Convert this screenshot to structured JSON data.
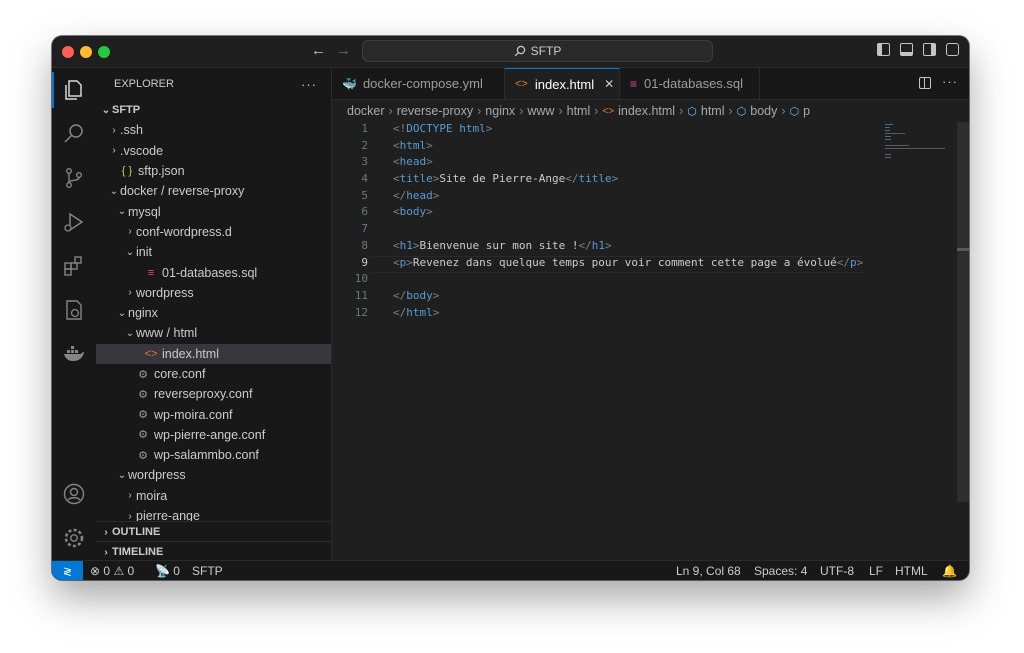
{
  "titlebar": {
    "command_center": "SFTP",
    "back_icon": "arrow-left-icon",
    "forward_icon": "arrow-right-icon"
  },
  "sidebar": {
    "title": "EXPLORER",
    "more": "···",
    "root": "SFTP",
    "items": [
      {
        "label": ".ssh",
        "depth": 1,
        "chevron": "›",
        "icon": ""
      },
      {
        "label": ".vscode",
        "depth": 1,
        "chevron": "›",
        "icon": ""
      },
      {
        "label": "sftp.json",
        "depth": 1,
        "chevron": "",
        "icon": "{ }"
      },
      {
        "label": "docker / reverse-proxy",
        "depth": 1,
        "chevron": "⌄",
        "icon": ""
      },
      {
        "label": "mysql",
        "depth": 2,
        "chevron": "⌄",
        "icon": ""
      },
      {
        "label": "conf-wordpress.d",
        "depth": 3,
        "chevron": "›",
        "icon": ""
      },
      {
        "label": "init",
        "depth": 3,
        "chevron": "⌄",
        "icon": ""
      },
      {
        "label": "01-databases.sql",
        "depth": 4,
        "chevron": "",
        "icon": "≡"
      },
      {
        "label": "wordpress",
        "depth": 3,
        "chevron": "›",
        "icon": ""
      },
      {
        "label": "nginx",
        "depth": 2,
        "chevron": "⌄",
        "icon": ""
      },
      {
        "label": "www / html",
        "depth": 3,
        "chevron": "⌄",
        "icon": ""
      },
      {
        "label": "index.html",
        "depth": 4,
        "chevron": "",
        "icon": "<>"
      },
      {
        "label": "core.conf",
        "depth": 3,
        "chevron": "",
        "icon": "⚙"
      },
      {
        "label": "reverseproxy.conf",
        "depth": 3,
        "chevron": "",
        "icon": "⚙"
      },
      {
        "label": "wp-moira.conf",
        "depth": 3,
        "chevron": "",
        "icon": "⚙"
      },
      {
        "label": "wp-pierre-ange.conf",
        "depth": 3,
        "chevron": "",
        "icon": "⚙"
      },
      {
        "label": "wp-salammbo.conf",
        "depth": 3,
        "chevron": "",
        "icon": "⚙"
      },
      {
        "label": "wordpress",
        "depth": 2,
        "chevron": "⌄",
        "icon": ""
      },
      {
        "label": "moira",
        "depth": 3,
        "chevron": "›",
        "icon": ""
      },
      {
        "label": "pierre-ange",
        "depth": 3,
        "chevron": "›",
        "icon": ""
      }
    ],
    "outline": "OUTLINE",
    "timeline": "TIMELINE"
  },
  "tabs": [
    {
      "label": "docker-compose.yml",
      "icon": "docker-icon",
      "active": false
    },
    {
      "label": "index.html",
      "icon": "html-icon",
      "active": true,
      "close": "✕"
    },
    {
      "label": "01-databases.sql",
      "icon": "database-icon",
      "active": false
    }
  ],
  "breadcrumbs": [
    "docker",
    "reverse-proxy",
    "nginx",
    "www",
    "html",
    "index.html",
    "html",
    "body",
    "p"
  ],
  "code": {
    "lines": [
      {
        "n": "1",
        "parts": [
          [
            "pun",
            "<!"
          ],
          [
            "doc",
            "DOCTYPE"
          ],
          [
            "txt",
            " "
          ],
          [
            "tag",
            "html"
          ],
          [
            "pun",
            ">"
          ]
        ]
      },
      {
        "n": "2",
        "parts": [
          [
            "pun",
            "<"
          ],
          [
            "tag",
            "html"
          ],
          [
            "pun",
            ">"
          ]
        ]
      },
      {
        "n": "3",
        "parts": [
          [
            "pun",
            "<"
          ],
          [
            "tag",
            "head"
          ],
          [
            "pun",
            ">"
          ]
        ]
      },
      {
        "n": "4",
        "parts": [
          [
            "pun",
            "<"
          ],
          [
            "tag",
            "title"
          ],
          [
            "pun",
            ">"
          ],
          [
            "txt",
            "Site de Pierre-Ange"
          ],
          [
            "pun",
            "</"
          ],
          [
            "tag",
            "title"
          ],
          [
            "pun",
            ">"
          ]
        ]
      },
      {
        "n": "5",
        "parts": [
          [
            "pun",
            "</"
          ],
          [
            "tag",
            "head"
          ],
          [
            "pun",
            ">"
          ]
        ]
      },
      {
        "n": "6",
        "parts": [
          [
            "pun",
            "<"
          ],
          [
            "tag",
            "body"
          ],
          [
            "pun",
            ">"
          ]
        ]
      },
      {
        "n": "7",
        "parts": []
      },
      {
        "n": "8",
        "parts": [
          [
            "pun",
            "<"
          ],
          [
            "tag",
            "h1"
          ],
          [
            "pun",
            ">"
          ],
          [
            "txt",
            "Bienvenue sur mon site !"
          ],
          [
            "pun",
            "</"
          ],
          [
            "tag",
            "h1"
          ],
          [
            "pun",
            ">"
          ]
        ]
      },
      {
        "n": "9",
        "parts": [
          [
            "pun",
            "<"
          ],
          [
            "tag",
            "p"
          ],
          [
            "pun",
            ">"
          ],
          [
            "txt",
            "Revenez dans quelque temps pour voir comment cette page a évolué"
          ],
          [
            "pun",
            "</"
          ],
          [
            "tag",
            "p"
          ],
          [
            "pun",
            ">"
          ]
        ]
      },
      {
        "n": "10",
        "parts": []
      },
      {
        "n": "11",
        "parts": [
          [
            "pun",
            "</"
          ],
          [
            "tag",
            "body"
          ],
          [
            "pun",
            ">"
          ]
        ]
      },
      {
        "n": "12",
        "parts": [
          [
            "pun",
            "</"
          ],
          [
            "tag",
            "html"
          ],
          [
            "pun",
            ">"
          ]
        ]
      }
    ],
    "current_line": "9"
  },
  "status": {
    "errors": "0",
    "warnings": "0",
    "ports": "0",
    "remote_name": "SFTP",
    "position": "Ln 9, Col 68",
    "spaces": "Spaces: 4",
    "encoding": "UTF-8",
    "eol": "LF",
    "language": "HTML"
  },
  "colors": {
    "accent": "#0078d4",
    "tag": "#569cd6",
    "punct": "#808080",
    "text": "#cccccc"
  }
}
